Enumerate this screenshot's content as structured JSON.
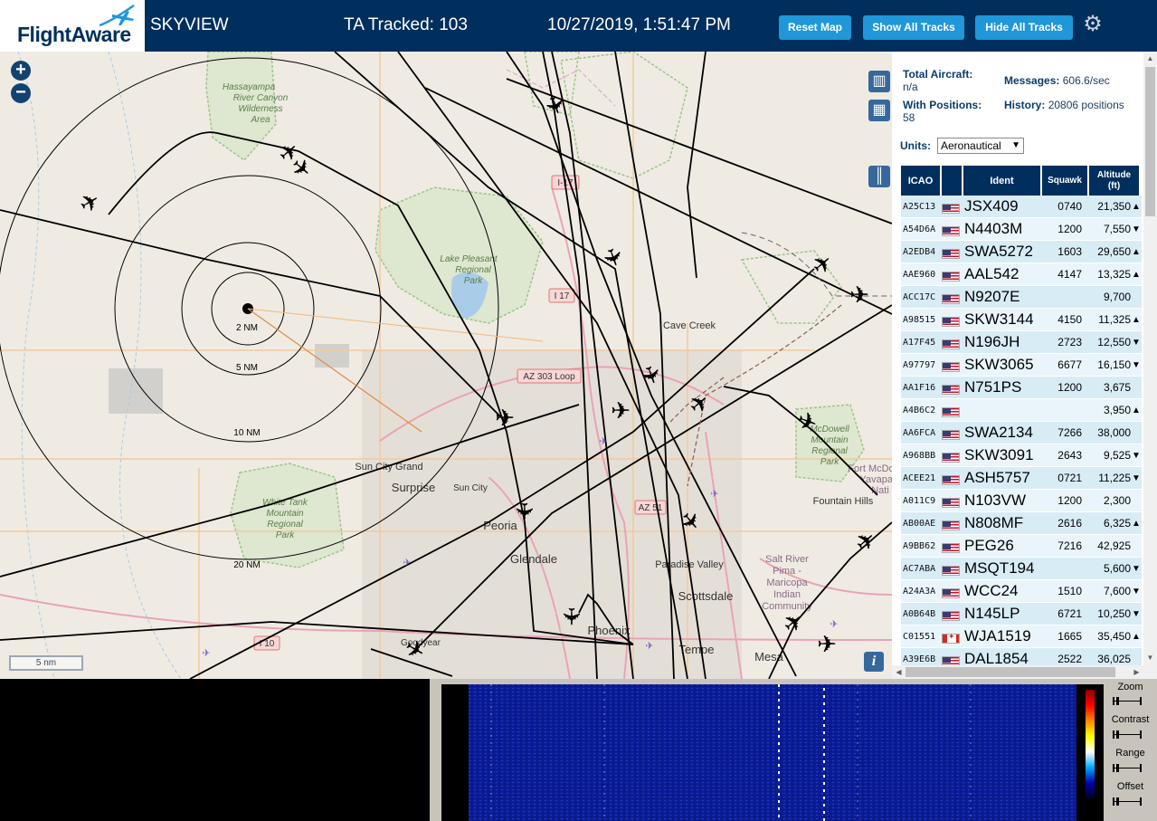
{
  "header": {
    "logo_text": "FlightAware",
    "title": "SKYVIEW",
    "tracked": "TA Tracked: 103",
    "datetime": "10/27/2019, 1:51:47 PM",
    "reset_map": "Reset Map",
    "show_all": "Show All Tracks",
    "hide_all": "Hide All Tracks"
  },
  "map": {
    "zoom_in": "+",
    "zoom_out": "−",
    "scale": "5 nm",
    "info": "i",
    "range_rings": [
      "2 NM",
      "5 NM",
      "10 NM",
      "20 NM"
    ],
    "labels": {
      "hassayampa": [
        "Hassayampa",
        "River Canyon",
        "Wilderness",
        "Area"
      ],
      "lake_pleasant": [
        "Lake Pleasant",
        "Regional",
        "Park"
      ],
      "white_tank": [
        "White Tank",
        "Mountain",
        "Regional",
        "Park"
      ],
      "mcdowell": [
        "McDowell",
        "Mountain",
        "Regional",
        "Park"
      ],
      "salt_river": [
        "Salt River",
        "Pima -",
        "Maricopa",
        "Indian",
        "Community"
      ],
      "cave_creek": "Cave Creek",
      "sun_city_grand": "Sun City Grand",
      "surprise": "Surprise",
      "sun_city": "Sun City",
      "peoria": "Peoria",
      "glendale": "Glendale",
      "phoenix": "Phoenix",
      "paradise_valley": "Paradise Valley",
      "scottsdale": "Scottsdale",
      "tempe": "Tempe",
      "mesa": "Mesa",
      "goodyear": "Goodyear",
      "fountain_hills": "Fountain Hills",
      "fort_mcdowell": [
        "Fort McDo",
        "Yavapai",
        "Nati"
      ],
      "i17_a": "I-17",
      "i17_b": "I 17",
      "az303": "AZ 303 Loop",
      "az51": "AZ 51",
      "i10": "I 10"
    }
  },
  "stats": {
    "total_label": "Total Aircraft:",
    "total_value": "n/a",
    "messages_label": "Messages:",
    "messages_value": "606.6/sec",
    "positions_label": "With Positions:",
    "positions_value": "58",
    "history_label": "History:",
    "history_value": "20806 positions"
  },
  "units": {
    "label": "Units:",
    "selected": "Aeronautical"
  },
  "table": {
    "headers": {
      "icao": "ICAO",
      "ident": "Ident",
      "squawk": "Squawk",
      "altitude": "Altitude",
      "altitude_unit": "(ft)"
    },
    "rows": [
      {
        "icao": "A25C13",
        "flag": "us",
        "ident": "JSX409",
        "squawk": "0740",
        "alt": "21,350",
        "trend": "▲"
      },
      {
        "icao": "A54D6A",
        "flag": "us",
        "ident": "N4403M",
        "squawk": "1200",
        "alt": "7,550",
        "trend": "▼"
      },
      {
        "icao": "A2EDB4",
        "flag": "us",
        "ident": "SWA5272",
        "squawk": "1603",
        "alt": "29,650",
        "trend": "▲"
      },
      {
        "icao": "AAE960",
        "flag": "us",
        "ident": "AAL542",
        "squawk": "4147",
        "alt": "13,325",
        "trend": "▲"
      },
      {
        "icao": "ACC17C",
        "flag": "us",
        "ident": "N9207E",
        "squawk": "",
        "alt": "9,700",
        "trend": ""
      },
      {
        "icao": "A98515",
        "flag": "us",
        "ident": "SKW3144",
        "squawk": "4150",
        "alt": "11,325",
        "trend": "▲"
      },
      {
        "icao": "A17F45",
        "flag": "us",
        "ident": "N196JH",
        "squawk": "2723",
        "alt": "12,550",
        "trend": "▼"
      },
      {
        "icao": "A97797",
        "flag": "us",
        "ident": "SKW3065",
        "squawk": "6677",
        "alt": "16,150",
        "trend": "▼"
      },
      {
        "icao": "AA1F16",
        "flag": "us",
        "ident": "N751PS",
        "squawk": "1200",
        "alt": "3,675",
        "trend": ""
      },
      {
        "icao": "A4B6C2",
        "flag": "us",
        "ident": "",
        "squawk": "",
        "alt": "3,950",
        "trend": "▲"
      },
      {
        "icao": "AA6FCA",
        "flag": "us",
        "ident": "SWA2134",
        "squawk": "7266",
        "alt": "38,000",
        "trend": ""
      },
      {
        "icao": "A968BB",
        "flag": "us",
        "ident": "SKW3091",
        "squawk": "2643",
        "alt": "9,525",
        "trend": "▼"
      },
      {
        "icao": "ACEE21",
        "flag": "us",
        "ident": "ASH5757",
        "squawk": "0721",
        "alt": "11,225",
        "trend": "▼"
      },
      {
        "icao": "A011C9",
        "flag": "us",
        "ident": "N103VW",
        "squawk": "1200",
        "alt": "2,300",
        "trend": ""
      },
      {
        "icao": "AB00AE",
        "flag": "us",
        "ident": "N808MF",
        "squawk": "2616",
        "alt": "6,325",
        "trend": "▲"
      },
      {
        "icao": "A9BB62",
        "flag": "us",
        "ident": "PEG26",
        "squawk": "7216",
        "alt": "42,925",
        "trend": ""
      },
      {
        "icao": "AC7ABA",
        "flag": "us",
        "ident": "MSQT194",
        "squawk": "",
        "alt": "5,600",
        "trend": "▼"
      },
      {
        "icao": "A24A3A",
        "flag": "us",
        "ident": "WCC24",
        "squawk": "1510",
        "alt": "7,600",
        "trend": "▼"
      },
      {
        "icao": "A0B64B",
        "flag": "us",
        "ident": "N145LP",
        "squawk": "6721",
        "alt": "10,250",
        "trend": "▼"
      },
      {
        "icao": "C01551",
        "flag": "ca",
        "ident": "WJA1519",
        "squawk": "1665",
        "alt": "35,450",
        "trend": "▲"
      },
      {
        "icao": "A39E6B",
        "flag": "us",
        "ident": "DAL1854",
        "squawk": "2522",
        "alt": "36,025",
        "trend": ""
      }
    ]
  },
  "waterfall": {
    "zoom": "Zoom",
    "contrast": "Contrast",
    "range": "Range",
    "offset": "Offset"
  }
}
